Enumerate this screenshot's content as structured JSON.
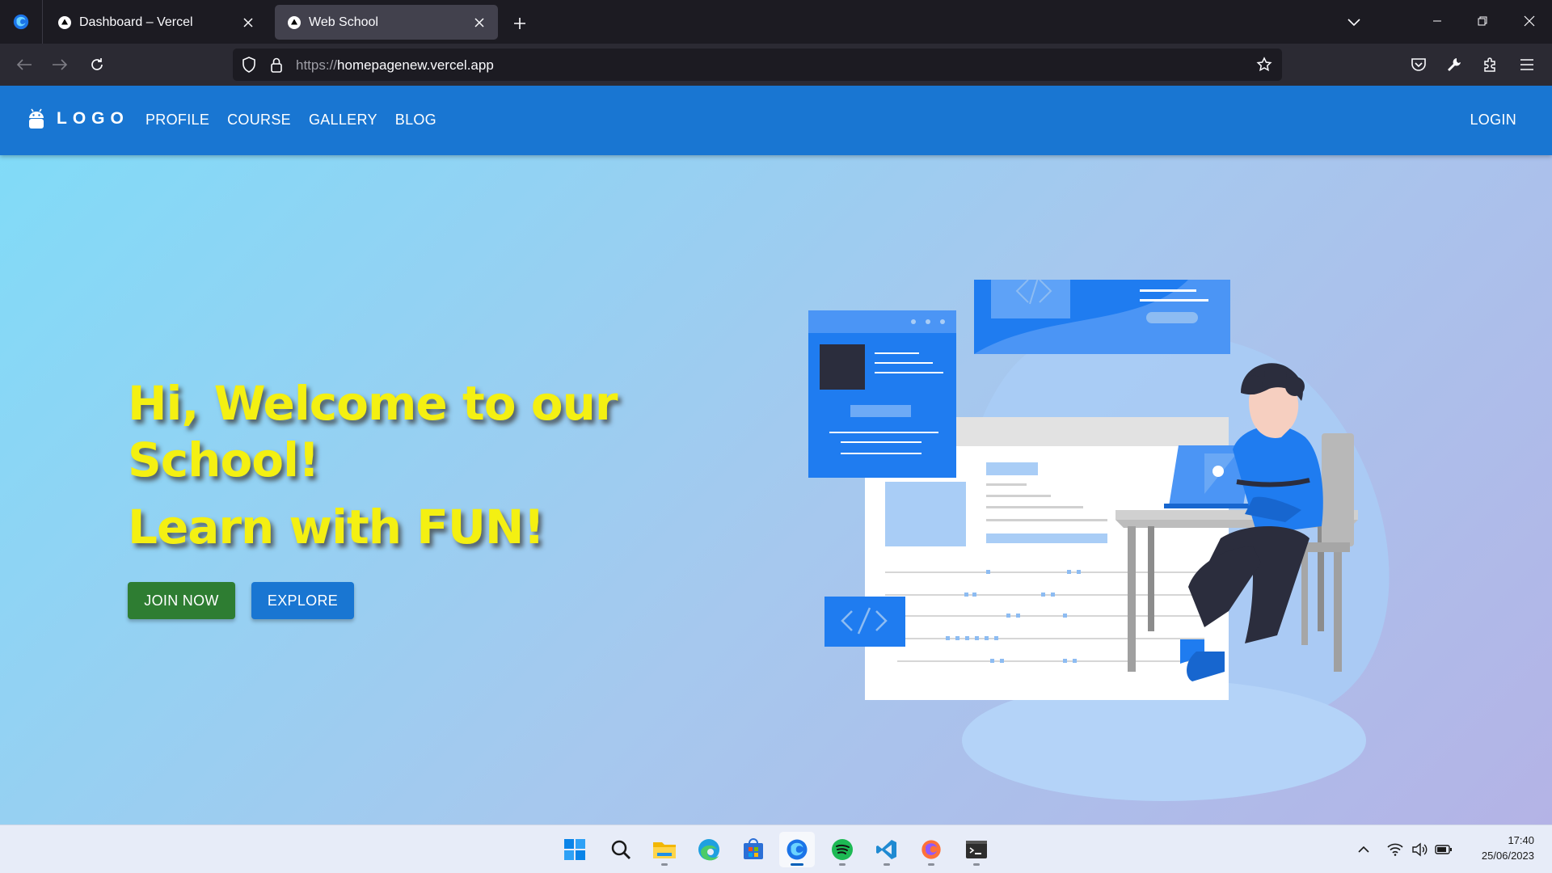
{
  "browser": {
    "tabs": [
      {
        "title": "Dashboard – Vercel",
        "active": false
      },
      {
        "title": "Web School",
        "active": true
      }
    ],
    "url": {
      "scheme": "https://",
      "host": "homepagenew.vercel.app"
    }
  },
  "site": {
    "logo_text": "LOGO",
    "menu": [
      "PROFILE",
      "COURSE",
      "GALLERY",
      "BLOG"
    ],
    "login_label": "LOGIN",
    "hero": {
      "title": "Hi, Welcome to our School!",
      "subtitle": "Learn with FUN!",
      "join_label": "JOIN NOW",
      "explore_label": "EXPLORE"
    },
    "colors": {
      "appbar": "#1976d2",
      "hero_text": "#f4f012",
      "join": "#2e7d32",
      "explore": "#1976d2"
    }
  },
  "taskbar": {
    "apps": [
      "start-icon",
      "search-icon",
      "file-explorer-icon",
      "edge-icon",
      "store-icon",
      "firefox-dev-icon",
      "spotify-icon",
      "vscode-icon",
      "firefox-icon",
      "terminal-icon"
    ],
    "time": "17:40",
    "date": "25/06/2023"
  }
}
